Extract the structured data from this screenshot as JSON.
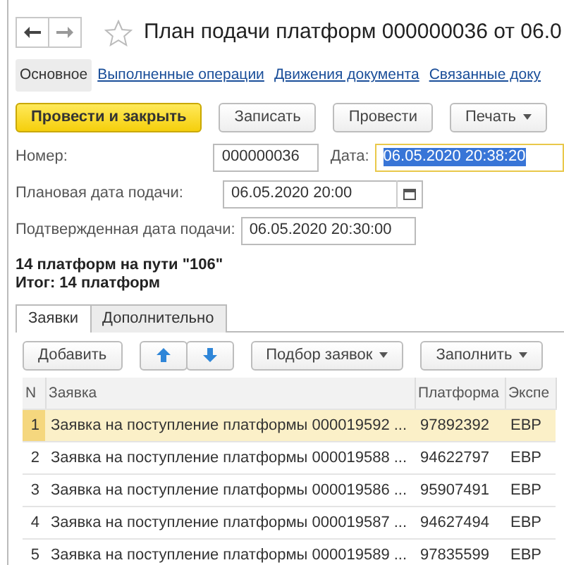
{
  "window": {
    "title": "План подачи платформ 000000036 от 06.0"
  },
  "nav": [
    {
      "label": "Основное",
      "selected": true
    },
    {
      "label": "Выполненные операции",
      "selected": false
    },
    {
      "label": "Движения документа",
      "selected": false
    },
    {
      "label": "Связанные доку",
      "selected": false
    }
  ],
  "command_bar": [
    {
      "label": "Провести и закрыть",
      "kind": "primary"
    },
    {
      "label": "Записать",
      "kind": "plain"
    },
    {
      "label": "Провести",
      "kind": "plain"
    },
    {
      "label": "Печать",
      "kind": "dropdown"
    }
  ],
  "number": {
    "label": "Номер:",
    "value": "000000036"
  },
  "date": {
    "label": "Дата:",
    "value": "06.05.2020 20:38:20"
  },
  "planned_date": {
    "label": "Плановая дата подачи:",
    "value": "06.05.2020 20:00"
  },
  "confirmed_date": {
    "label": "Подтвержденная дата подачи:",
    "value": "06.05.2020 20:30:00"
  },
  "summary": [
    "14 платформ на пути \"106\"",
    "Итог: 14 платформ"
  ],
  "tabs": [
    {
      "label": "Заявки",
      "selected": true
    },
    {
      "label": "Дополнительно",
      "selected": false
    }
  ],
  "table_toolbar": [
    {
      "label": "Добавить",
      "kind": "plain"
    },
    {
      "kind": "up"
    },
    {
      "kind": "down"
    },
    {
      "label": "Подбор заявок",
      "kind": "dropdown"
    },
    {
      "label": "Заполнить",
      "kind": "dropdown"
    }
  ],
  "table": {
    "columns": [
      "N",
      "Заявка",
      "Платформа",
      "Экспе"
    ],
    "rows": [
      {
        "cells": [
          "1",
          "Заявка на поступление платформы 000019592 ...",
          "97892392",
          "ЕВР"
        ],
        "selected": true
      },
      {
        "cells": [
          "2",
          "Заявка на поступление платформы 000019588 ...",
          "94622797",
          "ЕВР"
        ],
        "selected": false
      },
      {
        "cells": [
          "3",
          "Заявка на поступление платформы 000019586 ...",
          "95907491",
          "ЕВР"
        ],
        "selected": false
      },
      {
        "cells": [
          "4",
          "Заявка на поступление платформы 000019587 ...",
          "94627494",
          "ЕВР"
        ],
        "selected": false
      },
      {
        "cells": [
          "5",
          "Заявка на поступление платформы 000019589 ...",
          "97835599",
          "ЕВР"
        ],
        "selected": false
      }
    ]
  }
}
